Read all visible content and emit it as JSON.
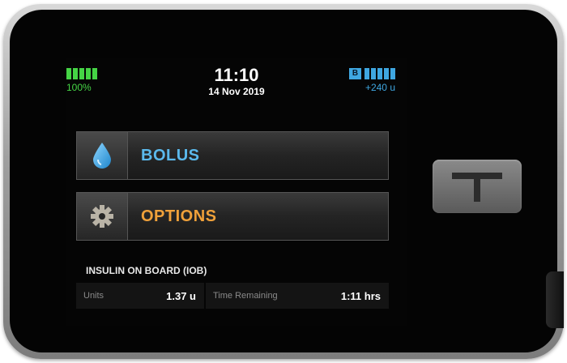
{
  "status_bar": {
    "battery_percent_label": "100%",
    "battery_level": 1.0,
    "time": "11:10",
    "date": "14 Nov 2019",
    "reservoir_badge": "B",
    "reservoir_amount": "+240 u"
  },
  "menu": {
    "bolus_label": "BOLUS",
    "options_label": "OPTIONS"
  },
  "iob": {
    "heading": "INSULIN ON BOARD (IOB)",
    "units_label": "Units",
    "units_value": "1.37 u",
    "time_label": "Time Remaining",
    "time_value": "1:11 hrs"
  },
  "colors": {
    "battery": "#45d445",
    "accent_blue": "#5bb9ec",
    "accent_orange": "#f0a13a",
    "screen_bg": "#050505"
  },
  "icons": {
    "bolus": "insulin-drop-icon",
    "options": "gear-icon"
  }
}
